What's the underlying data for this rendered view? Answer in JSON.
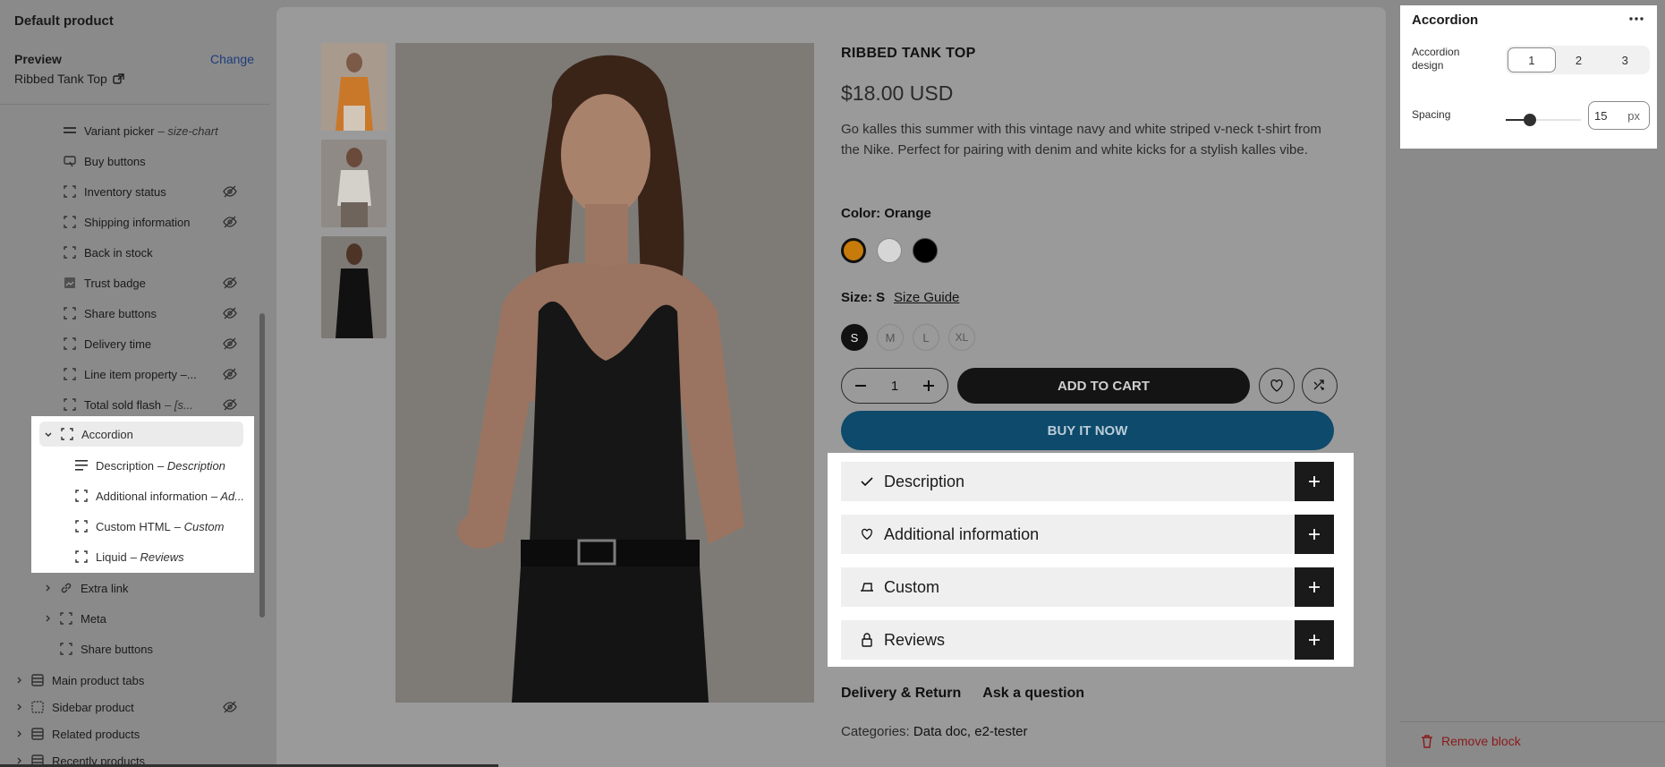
{
  "sidebar": {
    "title": "Default product",
    "preview_label": "Preview",
    "change_label": "Change",
    "product_name": "Ribbed Tank Top",
    "items": [
      {
        "label": "Variant picker",
        "suffix": "– size-chart"
      },
      {
        "label": "Buy buttons",
        "suffix": ""
      },
      {
        "label": "Inventory status",
        "suffix": ""
      },
      {
        "label": "Shipping information",
        "suffix": ""
      },
      {
        "label": "Back in stock",
        "suffix": ""
      },
      {
        "label": "Trust badge",
        "suffix": ""
      },
      {
        "label": "Share buttons",
        "suffix": ""
      },
      {
        "label": "Delivery time",
        "suffix": ""
      },
      {
        "label": "Line item property –...",
        "suffix": ""
      },
      {
        "label": "Total sold flash",
        "suffix": "– [s..."
      }
    ],
    "accordion": {
      "label": "Accordion",
      "children": [
        {
          "label": "Description",
          "suffix": "– Description"
        },
        {
          "label": "Additional information",
          "suffix": "– Ad..."
        },
        {
          "label": "Custom HTML",
          "suffix": "– Custom"
        },
        {
          "label": "Liquid",
          "suffix": "– Reviews"
        }
      ]
    },
    "after_items": [
      {
        "label": "Extra link"
      },
      {
        "label": "Meta"
      },
      {
        "label": "Share buttons"
      }
    ],
    "sections": [
      {
        "label": "Main product tabs"
      },
      {
        "label": "Sidebar product"
      },
      {
        "label": "Related products"
      },
      {
        "label": "Recently products"
      }
    ]
  },
  "product": {
    "title": "RIBBED TANK TOP",
    "price": "$18.00 USD",
    "description": "Go kalles this summer with this vintage navy and white striped v-neck t-shirt from the Nike. Perfect for pairing with denim and white kicks for a stylish kalles vibe.",
    "color_label": "Color: Orange",
    "swatch_colors": [
      "#c77b0a",
      "#d6d6d6",
      "#000000"
    ],
    "size_label": "Size: S",
    "size_guide": "Size Guide",
    "sizes": [
      "S",
      "M",
      "L",
      "XL"
    ],
    "quantity": "1",
    "add_to_cart": "ADD TO CART",
    "buy_it_now": "BUY IT NOW",
    "accordion_items": [
      "Description",
      "Additional information",
      "Custom",
      "Reviews"
    ],
    "links": [
      "Delivery & Return",
      "Ask a question"
    ],
    "categories_label": "Categories:",
    "categories_value": "Data doc, e2-tester"
  },
  "settings": {
    "title": "Accordion",
    "design_label": "Accordion design",
    "design_options": [
      "1",
      "2",
      "3"
    ],
    "design_selected": "1",
    "spacing_label": "Spacing",
    "spacing_value": "15",
    "spacing_unit": "px",
    "remove_label": "Remove block"
  },
  "colors": {
    "accent_link": "#1d3d7a",
    "buy_now": "#0e4a6b",
    "remove": "#8a1a1a"
  }
}
